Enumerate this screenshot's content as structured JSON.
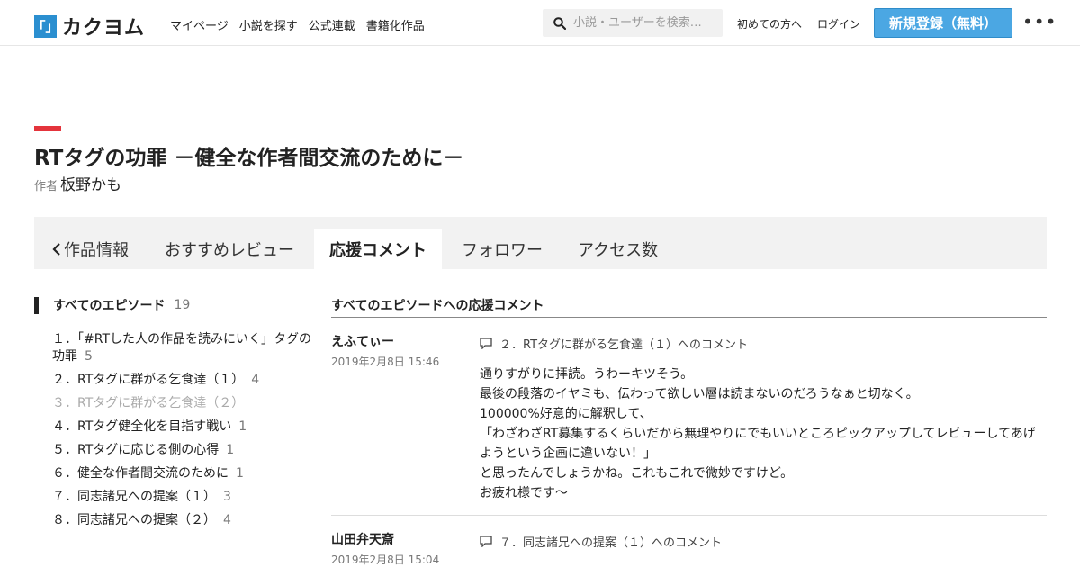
{
  "header": {
    "logo_mark": "「」",
    "logo_text": "カクヨム",
    "nav": [
      "マイページ",
      "小説を探す",
      "公式連載",
      "書籍化作品"
    ],
    "search_placeholder": "小説・ユーザーを検索…",
    "beginners": "初めての方へ",
    "login": "ログイン",
    "signup": "新規登録（無料）",
    "more": "•••"
  },
  "work": {
    "title": "RTタグの功罪 －健全な作者間交流のために－",
    "author_label": "作者",
    "author_name": "板野かも"
  },
  "tabs": [
    "作品情報",
    "おすすめレビュー",
    "応援コメント",
    "フォロワー",
    "アクセス数"
  ],
  "sidebar": {
    "heading": "すべてのエピソード",
    "count": "19",
    "episodes": [
      {
        "label": "１．「#RTした人の作品を読みにいく」タグの功罪",
        "count": "5"
      },
      {
        "label": "２．RTタグに群がる乞食達（１）",
        "count": "4"
      },
      {
        "label": "３．RTタグに群がる乞食達（２）",
        "count": ""
      },
      {
        "label": "４．RTタグ健全化を目指す戦い",
        "count": "1"
      },
      {
        "label": "５．RTタグに応じる側の心得",
        "count": "1"
      },
      {
        "label": "６．健全な作者間交流のために",
        "count": "1"
      },
      {
        "label": "７．同志諸兄への提案（１）",
        "count": "3"
      },
      {
        "label": "８．同志諸兄への提案（２）",
        "count": "4"
      }
    ]
  },
  "comments": {
    "heading": "すべてのエピソードへの応援コメント",
    "items": [
      {
        "user": "えふてぃー",
        "date": "2019年2月8日 15:46",
        "ref": "２．RTタグに群がる乞食達（１）へのコメント",
        "lines": [
          "通りすがりに拝読。うわーキツそう。",
          "最後の段落のイヤミも、伝わって欲しい層は読まないのだろうなぁと切なく。",
          "100000%好意的に解釈して、",
          "「わざわざRT募集するくらいだから無理やりにでもいいところピックアップしてレビューしてあげようという企画に違いない！」",
          "と思ったんでしょうかね。これもこれで微妙ですけど。",
          "お疲れ様です〜"
        ]
      },
      {
        "user": "山田弁天斎",
        "date": "2019年2月8日 15:04",
        "ref": "７．同志諸兄への提案（１）へのコメント",
        "lines": []
      }
    ]
  }
}
